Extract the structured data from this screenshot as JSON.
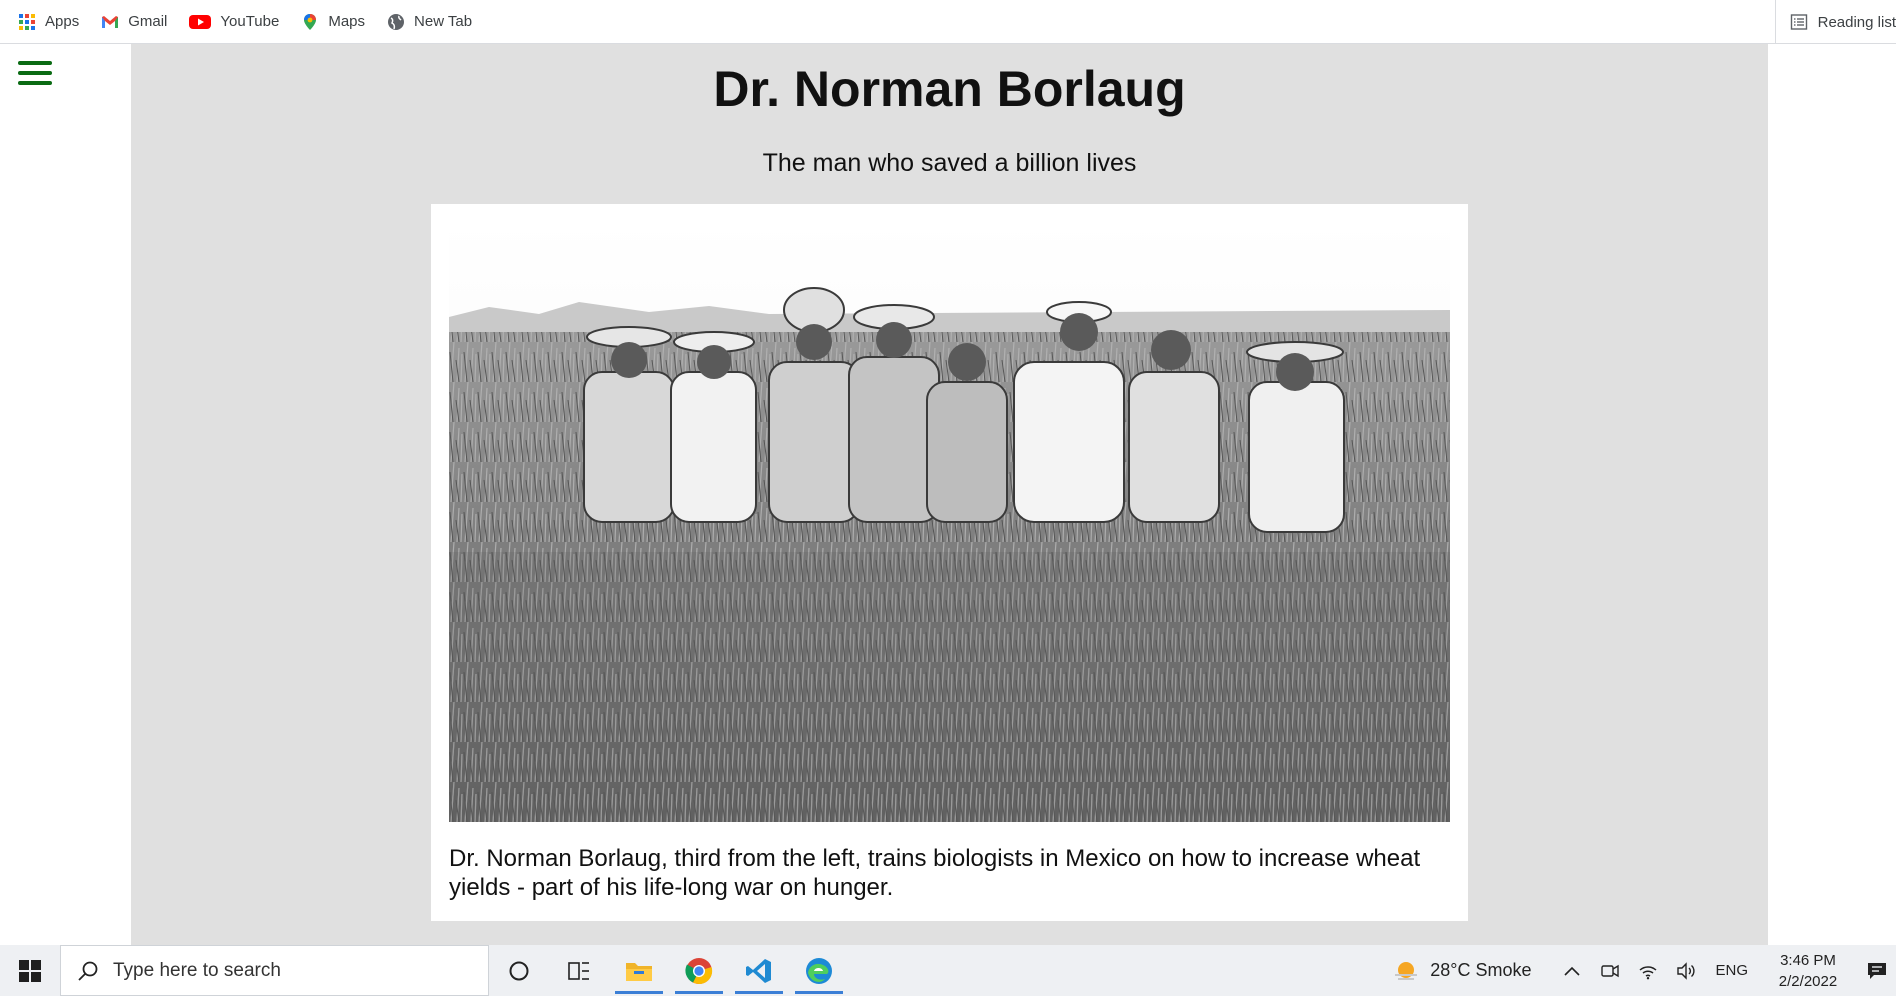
{
  "bookmarks": [
    {
      "label": "Apps",
      "icon": "apps-grid-icon"
    },
    {
      "label": "Gmail",
      "icon": "gmail-icon"
    },
    {
      "label": "YouTube",
      "icon": "youtube-icon"
    },
    {
      "label": "Maps",
      "icon": "maps-pin-icon"
    },
    {
      "label": "New Tab",
      "icon": "globe-icon"
    }
  ],
  "reading_list": {
    "label": "Reading list",
    "icon": "reading-list-icon"
  },
  "article": {
    "title": "Dr. Norman Borlaug",
    "subtitle": "The man who saved a billion lives",
    "caption": "Dr. Norman Borlaug, third from the left, trains biologists in Mexico on how to increase wheat yields - part of his life-long war on hunger."
  },
  "colors": {
    "hamburger": "#0a6b13",
    "main_bg": "#e0e0e0"
  },
  "taskbar": {
    "search_placeholder": "Type here to search",
    "weather": "28°C  Smoke",
    "language": "ENG",
    "time": "3:46 PM",
    "date": "2/2/2022"
  }
}
